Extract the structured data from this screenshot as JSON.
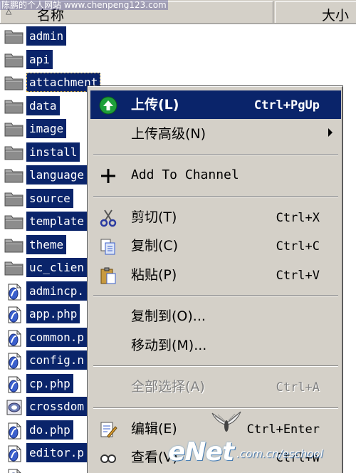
{
  "watermark_top": "陈鹏的个人网站    www.chenpeng123.com",
  "header": {
    "name_col": "名称",
    "size_col": "大小"
  },
  "files": [
    {
      "name": "admin",
      "type": "folder"
    },
    {
      "name": "api",
      "type": "folder"
    },
    {
      "name": "attachment",
      "type": "folder",
      "focused": true
    },
    {
      "name": "data",
      "type": "folder"
    },
    {
      "name": "image",
      "type": "folder"
    },
    {
      "name": "install",
      "type": "folder"
    },
    {
      "name": "language",
      "type": "folder"
    },
    {
      "name": "source",
      "type": "folder"
    },
    {
      "name": "template",
      "type": "folder"
    },
    {
      "name": "theme",
      "type": "folder"
    },
    {
      "name": "uc_clien",
      "type": "folder"
    },
    {
      "name": "admincp.",
      "type": "php"
    },
    {
      "name": "app.php",
      "type": "php"
    },
    {
      "name": "common.p",
      "type": "php"
    },
    {
      "name": "config.n",
      "type": "php"
    },
    {
      "name": "cp.php",
      "type": "php"
    },
    {
      "name": "crossdom",
      "type": "xml"
    },
    {
      "name": "do.php",
      "type": "php"
    },
    {
      "name": "editor.p",
      "type": "php"
    },
    {
      "name": "",
      "type": "php"
    }
  ],
  "context_menu": {
    "items": [
      {
        "label": "上传(L)",
        "shortcut": "Ctrl+PgUp",
        "icon": "upload-icon",
        "highlight": true
      },
      {
        "label": "上传高级(N)",
        "shortcut": "",
        "submenu": true
      },
      {
        "separator": true
      },
      {
        "label": "Add To Channel",
        "shortcut": "",
        "icon": "plus-icon",
        "mono": true
      },
      {
        "separator": true
      },
      {
        "label": "剪切(T)",
        "shortcut": "Ctrl+X",
        "icon": "scissors-icon"
      },
      {
        "label": "复制(C)",
        "shortcut": "Ctrl+C",
        "icon": "copy-icon"
      },
      {
        "label": "粘贴(P)",
        "shortcut": "Ctrl+V",
        "icon": "paste-icon"
      },
      {
        "separator": true
      },
      {
        "label": "复制到(O)...",
        "shortcut": ""
      },
      {
        "label": "移动到(M)...",
        "shortcut": ""
      },
      {
        "separator": true
      },
      {
        "label": "全部选择(A)",
        "shortcut": "Ctrl+A",
        "disabled": true
      },
      {
        "separator": true
      },
      {
        "label": "编辑(E)",
        "shortcut": "Ctrl+Enter",
        "icon": "edit-icon"
      },
      {
        "label": "查看(V)",
        "shortcut": "Ctrl+W",
        "icon": "view-icon"
      }
    ]
  },
  "watermark_logo": {
    "brand": "eNet",
    "domain": ".com.cn/eschool"
  },
  "colors": {
    "selection": "#0a246a",
    "menu_bg": "#d4d0c8",
    "header_bg": "#d4d0c8"
  }
}
